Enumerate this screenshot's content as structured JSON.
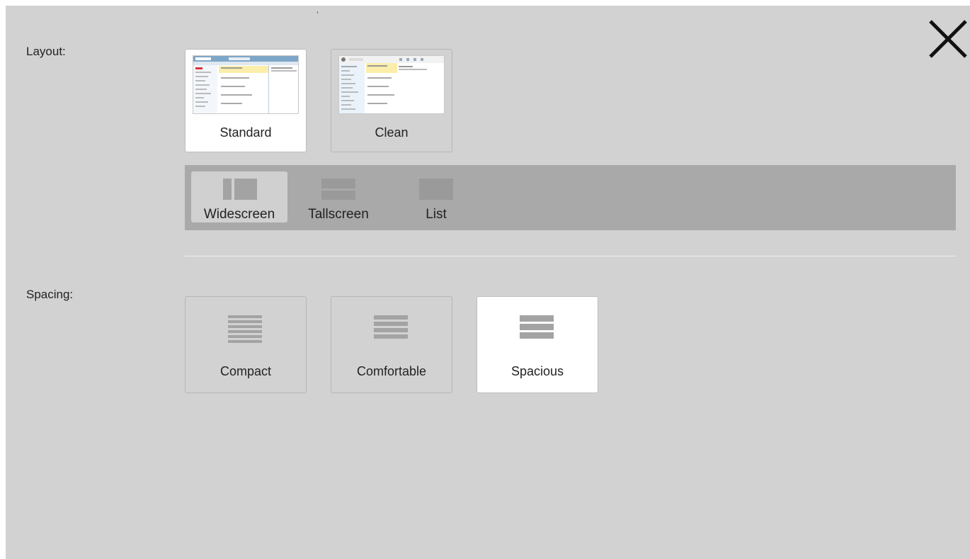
{
  "layout": {
    "label": "Layout:",
    "options": [
      {
        "label": "Standard",
        "selected": true
      },
      {
        "label": "Clean",
        "selected": false
      }
    ],
    "views": [
      {
        "label": "Widescreen",
        "icon": "widescreen-icon",
        "selected": true
      },
      {
        "label": "Tallscreen",
        "icon": "tallscreen-icon",
        "selected": false
      },
      {
        "label": "List",
        "icon": "list-view-icon",
        "selected": false
      }
    ]
  },
  "spacing": {
    "label": "Spacing:",
    "options": [
      {
        "label": "Compact",
        "icon": "compact-spacing-icon",
        "selected": false
      },
      {
        "label": "Comfortable",
        "icon": "comfortable-spacing-icon",
        "selected": false
      },
      {
        "label": "Spacious",
        "icon": "spacious-spacing-icon",
        "selected": true
      }
    ]
  },
  "close": {
    "icon": "close-icon"
  },
  "colors": {
    "panel": "#d2d2d2",
    "viewbar": "#a9a9a9",
    "selected": "#ffffff",
    "icon": "#a3a3a3"
  }
}
